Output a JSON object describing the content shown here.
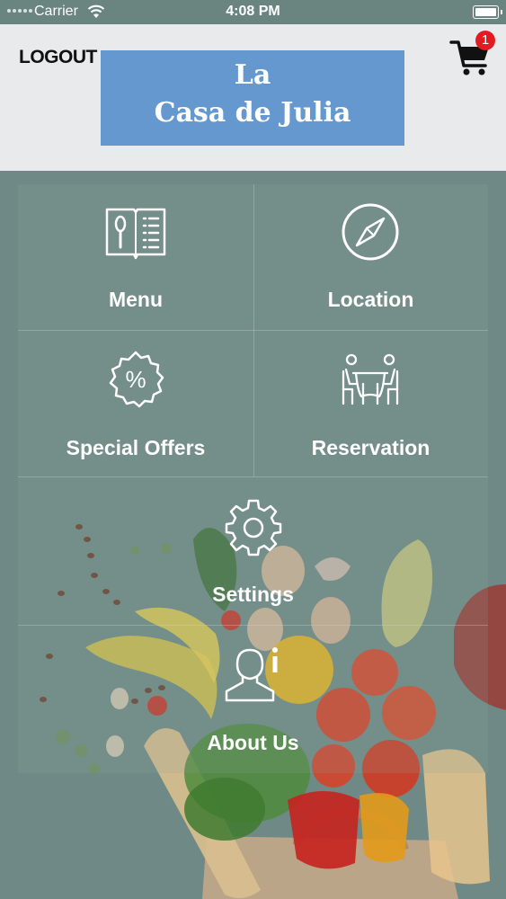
{
  "status_bar": {
    "carrier": "Carrier",
    "time": "4:08 PM"
  },
  "header": {
    "logout_label": "LOGOUT",
    "logo_line1": "La",
    "logo_line2": "Casa de Julia",
    "cart_count": "1"
  },
  "menu": {
    "items": [
      {
        "label": "Menu",
        "icon": "menu-book-icon"
      },
      {
        "label": "Location",
        "icon": "compass-icon"
      },
      {
        "label": "Special Offers",
        "icon": "percent-badge-icon"
      },
      {
        "label": "Reservation",
        "icon": "reservation-table-icon"
      },
      {
        "label": "Settings",
        "icon": "gear-icon"
      },
      {
        "label": "About Us",
        "icon": "user-info-icon"
      }
    ]
  },
  "colors": {
    "header_bg": "#e9eaec",
    "logo_bg": "#6598cf",
    "badge": "#e21b23",
    "overlay": "#6f8a86"
  }
}
